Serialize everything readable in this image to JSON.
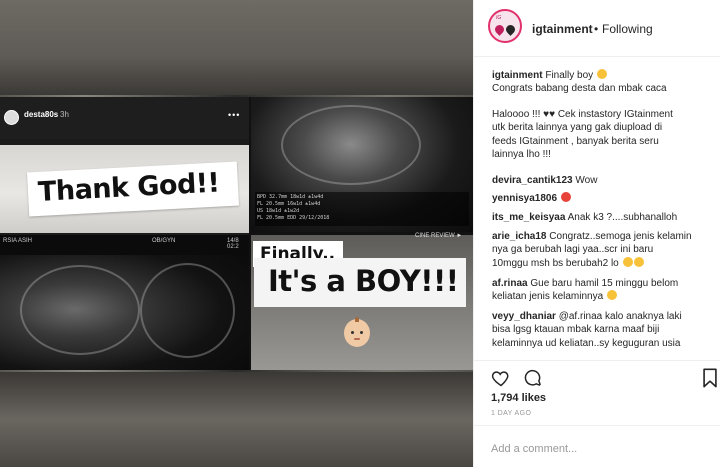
{
  "post_image": {
    "story": {
      "username": "desta80s",
      "time": "3h",
      "caption_card": "Thank God!!",
      "scan_header_left": "RSIA ASIH",
      "scan_header_mid": "OB/GYN",
      "scan_header_right": "14/8 02:2"
    },
    "ultrasound": {
      "table_rows": [
        "BPD   32.7mm  18w1d  ±1w4d",
        "FL    20.5mm  16w1d  ±1w4d",
        "              US   18w1d  ±1w2d",
        "FL    20.5mm  EDD  29/12/2018"
      ],
      "cine_label": "CINE REVIEW ►"
    },
    "finally_card": "Finally..",
    "boy_card": "It's a BOY!!!"
  },
  "header": {
    "username": "igtainment",
    "separator": "•",
    "follow_state": "Following"
  },
  "caption": {
    "username": "igtainment",
    "line1": "Finally boy",
    "line2": "Congrats babang desta dan mbak caca",
    "line3": "Haloooo !!!",
    "line3b": "Cek instastory IGtainment",
    "line4": "utk berita lainnya yang gak diupload di",
    "line5": "feeds IGtainment , banyak berita seru",
    "line6": "lainnya lho !!!"
  },
  "comments": [
    {
      "username": "devira_cantik123",
      "text": "Wow"
    },
    {
      "username": "yennisya1806",
      "text": ""
    },
    {
      "username": "its_me_keisyaa",
      "text": "Anak k3 ?....subhanalloh"
    },
    {
      "username": "arie_icha18",
      "text_l1": "Congratz..semoga jenis kelamin",
      "text_l2": "nya ga berubah lagi yaa..scr ini baru",
      "text_l3": "10mggu msh bs berubah2 lo"
    },
    {
      "username": "af.rinaa",
      "text_l1": "Gue baru hamil 15 minggu belom",
      "text_l2": "keliatan jenis kelaminnya"
    },
    {
      "username": "veyy_dhaniar",
      "text_l1": "@af.rinaa kalo anaknya laki",
      "text_l2": "bisa lgsg ktauan mbak karna maaf biji",
      "text_l3": "kelaminnya ud keliatan..sy keguguran usia"
    }
  ],
  "footer": {
    "likes": "1,794 likes",
    "time_ago": "1 DAY AGO",
    "add_comment_placeholder": "Add a comment..."
  },
  "icons": [
    "heart-icon",
    "comment-icon",
    "bookmark-icon",
    "more-icon",
    "baby-emoji"
  ]
}
